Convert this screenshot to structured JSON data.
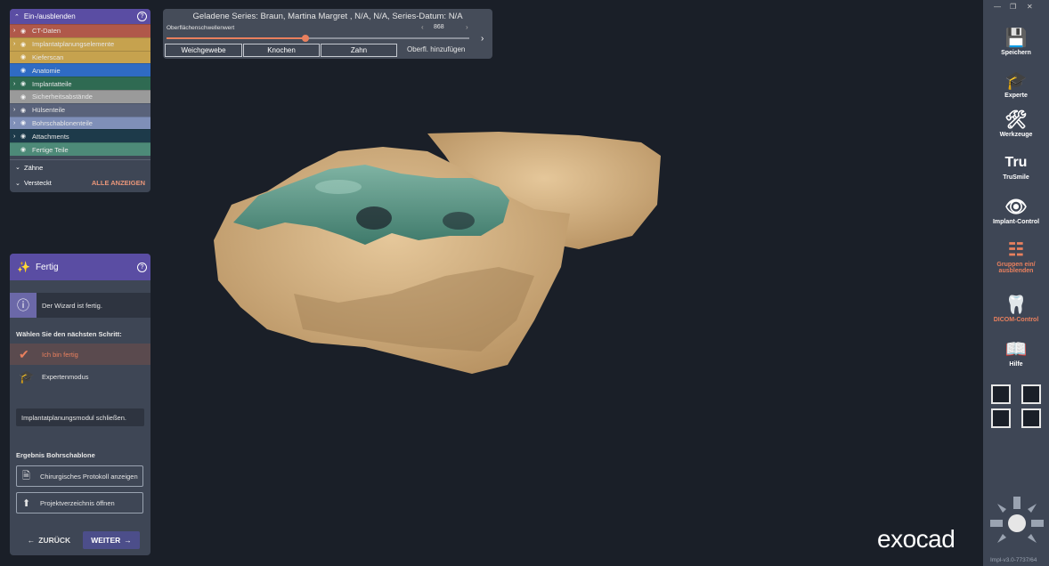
{
  "groups_panel": {
    "title": "Ein-/ausblenden",
    "help": "?",
    "rows": [
      {
        "label": "CT-Daten",
        "color": "#b0584a",
        "chevron": true
      },
      {
        "label": "Implantatplanungselemente",
        "color": "#c6a24e",
        "chevron": true
      },
      {
        "label": "Kieferscan",
        "color": "#c6a24e",
        "chevron": false
      },
      {
        "label": "Anatomie",
        "color": "#2f6bc3",
        "chevron": false
      },
      {
        "label": "Implantatteile",
        "color": "#2f6a52",
        "chevron": true
      },
      {
        "label": "Sicherheitsabstände",
        "color": "#9a9a9a",
        "chevron": false
      },
      {
        "label": "Hülsenteile",
        "color": "#59627a",
        "chevron": true
      },
      {
        "label": "Bohrschablonenteile",
        "color": "#7f8fb8",
        "chevron": true
      },
      {
        "label": "Attachments",
        "color": "#1d3a4a",
        "chevron": true
      },
      {
        "label": "Fertige Teile",
        "color": "#4d8a78",
        "chevron": false
      }
    ],
    "teeth_label": "Zähne",
    "hidden_label": "Versteckt",
    "show_all": "ALLE ANZEIGEN"
  },
  "wizard": {
    "title": "Fertig",
    "help": "?",
    "info_text": "Der Wizard ist fertig.",
    "next_step_label": "Wählen Sie den nächsten Schritt:",
    "option_done": "Ich bin fertig",
    "option_expert": "Expertenmodus",
    "close_module": "Implantatplanungsmodul schließen.",
    "result_label": "Ergebnis Bohrschablone",
    "protocol_button": "Chirurgisches Protokoll anzeigen",
    "folder_button": "Projektverzeichnis öffnen",
    "back_button": "ZURÜCK",
    "next_button": "WEITER"
  },
  "series_panel": {
    "title": "Geladene Series: Braun, Martina Margret , N/A, N/A, Series-Datum: N/A",
    "slider_label": "Oberflächenschwellenwert",
    "value": "868",
    "slider_fraction": 0.46,
    "btn_soft": "Weichgewebe",
    "btn_bone": "Knochen",
    "btn_tooth": "Zahn",
    "add_surface": "Oberfl. hinzufügen"
  },
  "toolbar": {
    "items": [
      {
        "label": "Speichern",
        "icon": "save-icon"
      },
      {
        "label": "Experte",
        "icon": "graduation-cap-icon"
      },
      {
        "label": "Werkzeuge",
        "icon": "tools-icon"
      },
      {
        "label": "TruSmile",
        "icon": "trusmile-icon"
      },
      {
        "label": "Implant-Control",
        "icon": "implant-eye-icon"
      },
      {
        "label": "Gruppen ein/ ausblenden",
        "icon": "groups-eye-icon"
      },
      {
        "label": "DICOM-Control",
        "icon": "jaw-icon"
      },
      {
        "label": "Hilfe",
        "icon": "help-book-icon"
      }
    ],
    "active_color": "#e9805e"
  },
  "brand": "exocad",
  "version": "Impl-v3.0-7737/64"
}
